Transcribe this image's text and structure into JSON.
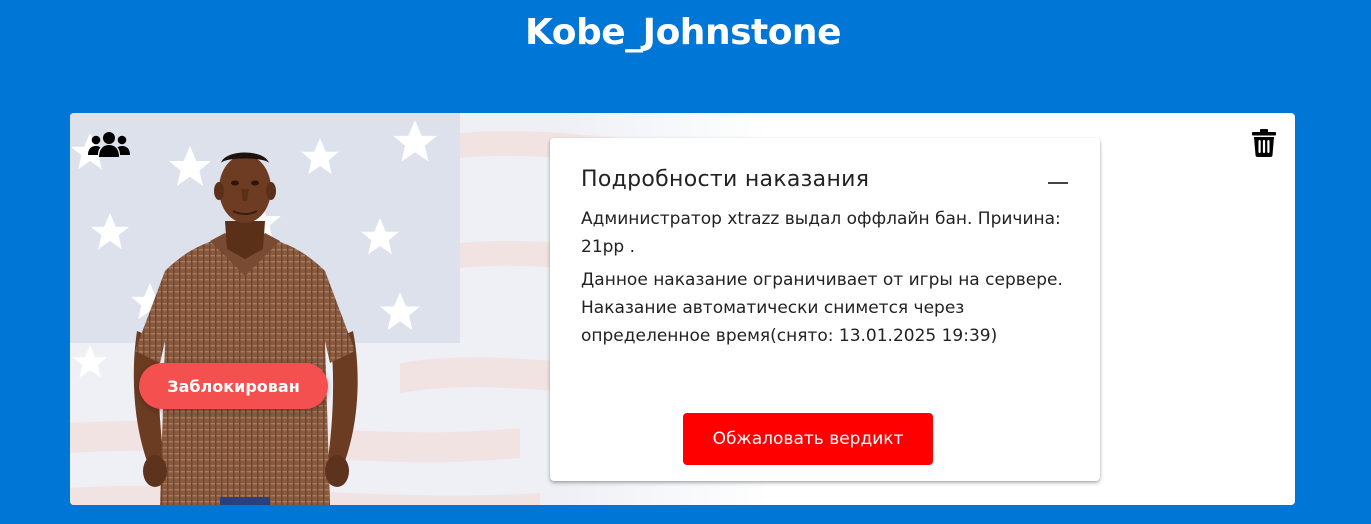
{
  "header": {
    "title": "Kobe_Johnstone"
  },
  "profile": {
    "status_badge": "Заблокирован",
    "icons": {
      "group": "users-group-icon",
      "delete": "trash-icon"
    }
  },
  "punishment": {
    "title": "Подробности наказания",
    "collapse_icon": "minus-icon",
    "reason_text": "Администратор xtrazz выдал оффлайн бан. Причина: 21рр .",
    "info_text": "Данное наказание ограничивает от игры на сервере. Наказание автоматически снимется через определенное время(снято: 13.01.2025 19:39)",
    "appeal_button": "Обжаловать вердикт"
  },
  "colors": {
    "background": "#0076d6",
    "badge": "#f45050",
    "appeal_button": "#ff0000"
  }
}
